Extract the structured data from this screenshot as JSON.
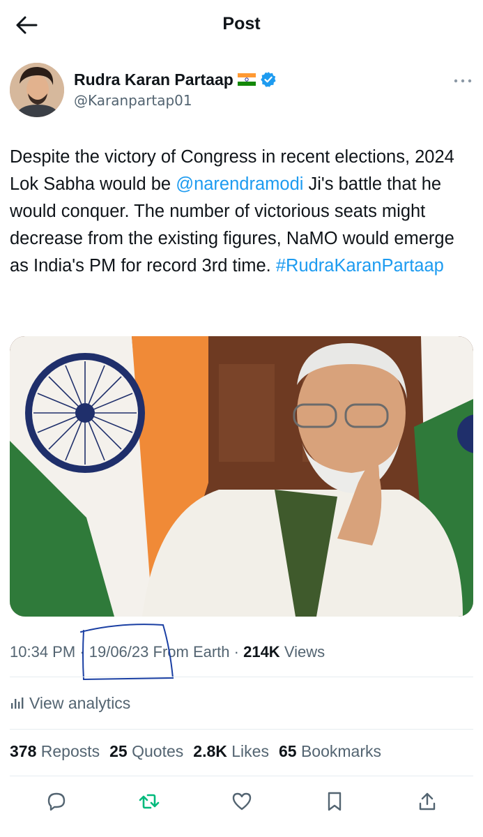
{
  "header": {
    "title": "Post",
    "back_icon": "arrow-left-icon"
  },
  "author": {
    "display_name": "Rudra Karan Partaap",
    "flag_icon": "india-flag-icon",
    "verified_icon": "verified-badge-icon",
    "handle": "@Karanpartap01",
    "more_icon": "more-dots-icon"
  },
  "tweet": {
    "part1": "Despite the victory of Congress in recent elections, 2024 Lok Sabha would be ",
    "mention": "@narendramodi",
    "part2": " Ji's battle that he would conquer. The number of victorious seats might decrease from the existing figures, NaMO would emerge as India's PM for record 3rd time. ",
    "hashtag": "#RudraKaranPartaap"
  },
  "meta": {
    "time": "10:34 PM",
    "date": "19/06/23",
    "location": "From Earth",
    "views_count": "214K",
    "views_label": "Views"
  },
  "analytics": {
    "label": "View analytics",
    "icon": "analytics-icon"
  },
  "stats": {
    "reposts": {
      "count": "378",
      "label": "Reposts"
    },
    "quotes": {
      "count": "25",
      "label": "Quotes"
    },
    "likes": {
      "count": "2.8K",
      "label": "Likes"
    },
    "bookmarks": {
      "count": "65",
      "label": "Bookmarks"
    }
  },
  "actions": [
    "reply-icon",
    "repost-icon",
    "like-icon",
    "bookmark-icon",
    "share-icon"
  ],
  "colors": {
    "link": "#1d9bf0",
    "muted": "#536471",
    "repost_green": "#00ba7c",
    "annotation_ink": "#1a3fa3"
  }
}
